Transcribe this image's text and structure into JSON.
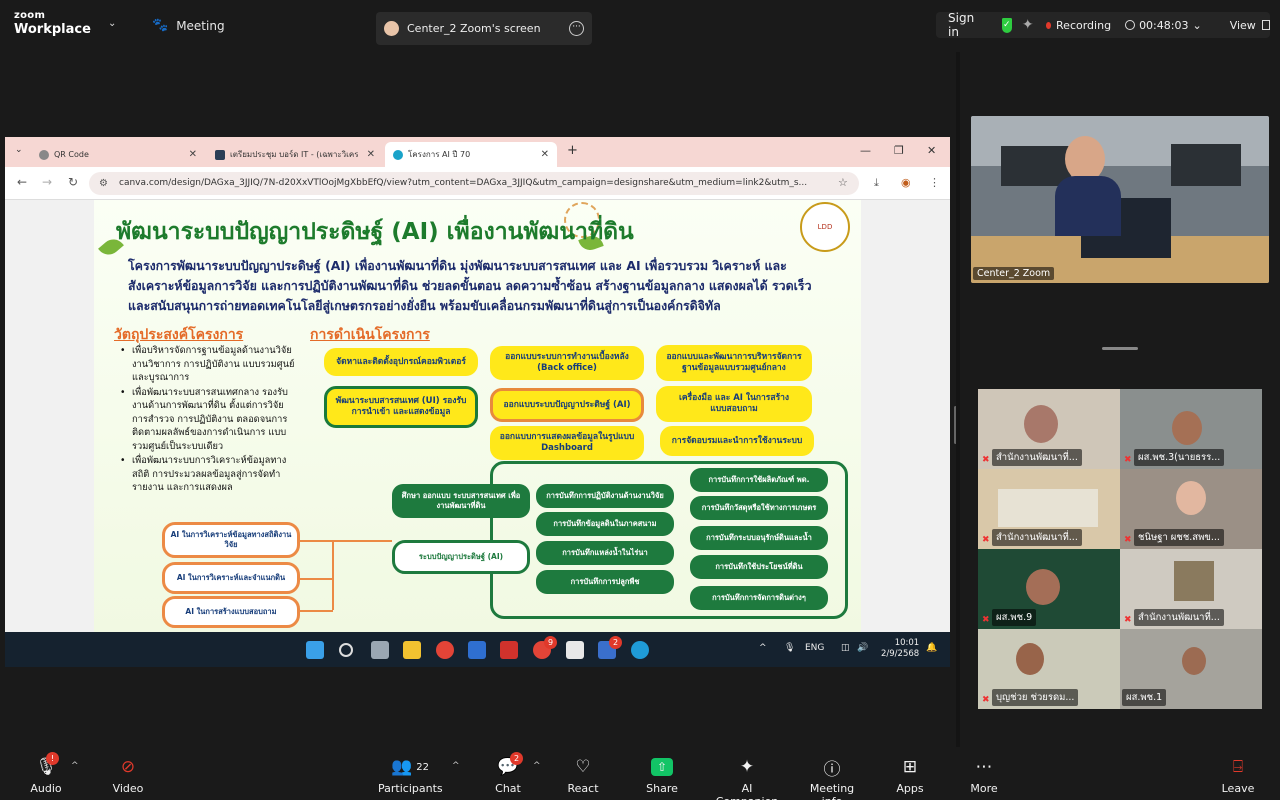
{
  "app": {
    "brand_top": "zoom",
    "brand_bottom": "Workplace",
    "meeting_label": "Meeting",
    "share_title": "Center_2 Zoom's screen"
  },
  "status": {
    "sign_in": "Sign in",
    "recording": "Recording",
    "timer": "00:48:03",
    "view": "View"
  },
  "browser": {
    "tabs": [
      {
        "title": "QR Code"
      },
      {
        "title": "เตรียมประชุม บอร์ด IT - (เฉพาะวิเคร"
      },
      {
        "title": "โครงการ AI ปี 70"
      }
    ],
    "url": "canva.com/design/DAGxa_3JJIQ/7N-d20XxVTlOojMgXbbEfQ/view?utm_content=DAGxa_3JJIQ&utm_campaign=designshare&utm_medium=link2&utm_s..."
  },
  "slide": {
    "title": "พัฒนาระบบปัญญาประดิษฐ์ (AI) เพื่องานพัฒนาที่ดิน",
    "subtitle": "โครงการพัฒนาระบบปัญญาประดิษฐ์ (AI) เพื่องานพัฒนาที่ดิน มุ่งพัฒนาระบบสารสนเทศ และ AI เพื่อรวบรวม วิเคราะห์ และสังเคราะห์ข้อมูลการวิจัย และการปฏิบัติงานพัฒนาที่ดิน ช่วยลดขั้นตอน ลดความซ้ำซ้อน สร้างฐานข้อมูลกลาง แสดงผลได้ รวดเร็ว และสนับสนุนการถ่ายทอดเทคโนโลยีสู่เกษตรกรอย่างยั่งยืน พร้อมขับเคลื่อนกรมพัฒนาที่ดินสู่การเป็นองค์กรดิจิทัล",
    "seal_text": "LDD",
    "objectives_heading": "วัตถุประสงค์โครงการ",
    "objectives": [
      "เพื่อบริหารจัดการฐานข้อมูลด้านงานวิจัย งานวิชาการ การปฏิบัติงาน แบบรวมศูนย์และบูรณาการ",
      "เพื่อพัฒนาระบบสารสนเทศกลาง รองรับงานด้านการพัฒนาที่ดิน ตั้งแต่การวิจัย การสำรวจ การปฏิบัติงาน ตลอดจนการติดตามผลลัพธ์ของการดำเนินการ แบบรวมศูนย์เป็นระบบเดียว",
      "เพื่อพัฒนาระบบการวิเคราะห์ข้อมูลทางสถิติ การประมวลผลข้อมูลสู่การจัดทำรายงาน และการแสดงผล"
    ],
    "operations_heading": "การดำเนินโครงการ",
    "ops": [
      "จัดหาและติดตั้งอุปกรณ์คอมพิวเตอร์",
      "ออกแบบระบบการทำงานเบื้องหลัง (Back office)",
      "ออกแบบและพัฒนาการบริหารจัดการฐานข้อมูลแบบรวมศูนย์กลาง",
      "พัฒนาระบบสารสนเทศ (UI) รองรับการนำเข้า และแสดงข้อมูล",
      "ออกแบบระบบปัญญาประดิษฐ์ (AI)",
      "เครื่องมือ และ AI ในการสร้างแบบสอบถาม",
      "ออกแบบการแสดงผลข้อมูลในรูปแบบ Dashboard",
      "การจัดอบรมและนำการใช้งานระบบ"
    ],
    "study": "ศึกษา ออกแบบ ระบบสารสนเทศ เพื่องานพัฒนาที่ดิน",
    "ai_system": "ระบบปัญญาประดิษฐ์ (AI)",
    "ai_tools": [
      "AI ในการวิเคราะห์ข้อมูลทางสถิติงานวิจัย",
      "AI ในการวิเคราะห์และจำแนกดิน",
      "AI ในการสร้างแบบสอบถาม"
    ],
    "rec_left": [
      "การบันทึกการปฏิบัติงานด้านงานวิจัย",
      "การบันทึกข้อมูลดินในภาคสนาม",
      "การบันทึกแหล่งน้ำในไร่นา",
      "การบันทึกการปลูกพืช"
    ],
    "rec_right": [
      "การบันทึกการใช้ผลิตภัณฑ์ พด.",
      "การบันทึกวัสดุหรือใช้ทางการเกษตร",
      "การบันทึกระบบอนุรักษ์ดินและน้ำ",
      "การบันทึกใช้ประโยชน์ที่ดิน",
      "การบันทึกการจัดการดินต่างๆ"
    ]
  },
  "taskbar": {
    "lang": "ENG",
    "time": "10:01",
    "date": "2/9/2568",
    "chrome_badge": "9",
    "app_badge": "2"
  },
  "participants_video": {
    "speaker": "Center_2 Zoom",
    "tiles": [
      "สำนักงานพัฒนาที่...",
      "ผส.พช.3(นายธรร...",
      "สำนักงานพัฒนาที่...",
      "ชนิษฐา ผชช.สพข...",
      "ผส.พช.9",
      "สำนักงานพัฒนาที่...",
      "บุญช่วย ช่วยรดม...",
      "ผส.พช.1"
    ]
  },
  "toolbar": {
    "audio": "Audio",
    "video": "Video",
    "participants": "Participants",
    "participants_count": "22",
    "chat": "Chat",
    "chat_badge": "2",
    "react": "React",
    "share": "Share",
    "ai_companion": "AI Companion",
    "meeting_info": "Meeting info",
    "apps": "Apps",
    "more": "More",
    "leave": "Leave",
    "audio_badge": "!"
  }
}
